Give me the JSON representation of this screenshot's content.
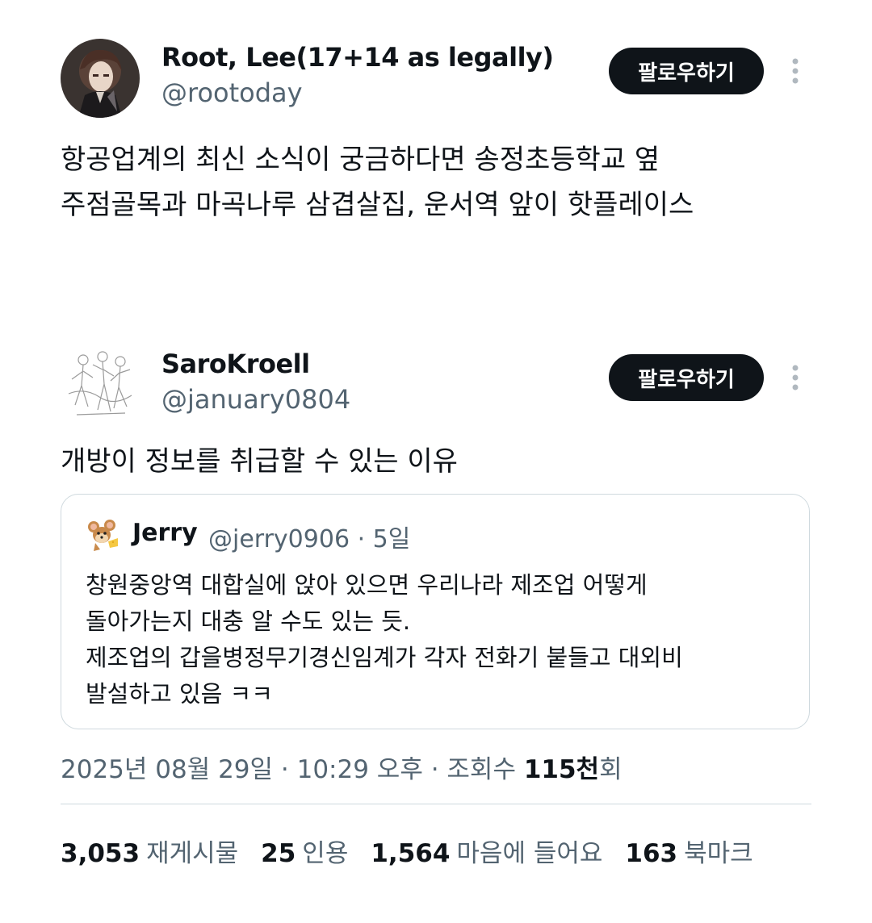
{
  "posts": [
    {
      "author": {
        "name": "Root, Lee(17+14 as legally)",
        "handle": "@rootoday",
        "avatar_icon": "dark-anime-portrait-avatar"
      },
      "follow_label": "팔로우하기",
      "text_lines": [
        "항공업계의 최신 소식이 궁금하다면 송정초등학교 옆",
        "주점골목과 마곡나루 삼겹살집, 운서역 앞이 핫플레이스"
      ]
    },
    {
      "author": {
        "name": "SaroKroell",
        "handle": "@january0804",
        "avatar_icon": "line-sketch-figures-avatar"
      },
      "follow_label": "팔로우하기",
      "text_lines": [
        "개방이 정보를 취급할 수 있는 이유"
      ],
      "quote": {
        "name": "Jerry",
        "handle": "@jerry0906 · 5일",
        "avatar_icon": "cartoon-mouse-avatar",
        "text_lines": [
          "창원중앙역 대합실에 앉아 있으면 우리나라 제조업 어떻게",
          "돌아가는지 대충 알 수도 있는 듯.",
          "제조업의 갑을병정무기경신임계가 각자 전화기 붙들고 대외비",
          "발설하고 있음 ㅋㅋ"
        ]
      },
      "meta": {
        "datetime": "2025년 08월 29일 · 10:29 오후 · 조회수 ",
        "views": "115천",
        "views_suffix": "회"
      },
      "stats": [
        {
          "count": "3,053",
          "label": "재게시물"
        },
        {
          "count": "25",
          "label": "인용"
        },
        {
          "count": "1,564",
          "label": "마음에 들어요"
        },
        {
          "count": "163",
          "label": "북마크"
        }
      ]
    }
  ],
  "colors": {
    "text": "#0f1419",
    "secondary": "#536471",
    "border": "#cfd9de",
    "button_bg": "#0f1419",
    "button_text": "#ffffff"
  }
}
